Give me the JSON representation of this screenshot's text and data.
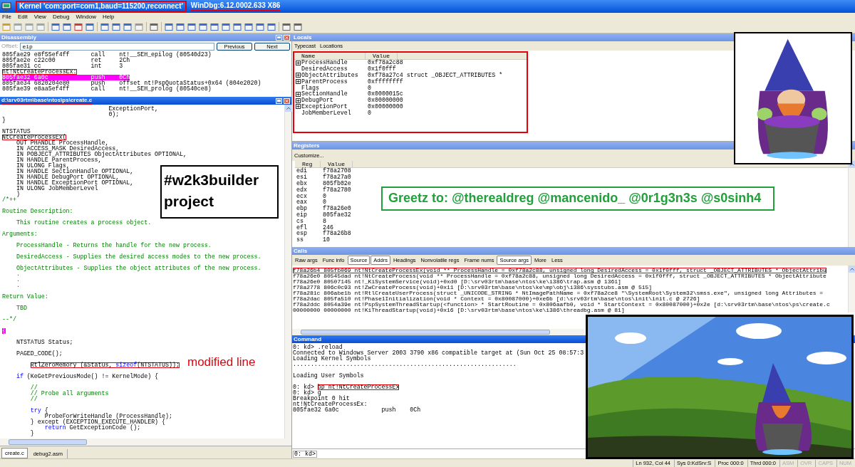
{
  "window": {
    "title": "Kernel 'com:port=com1,baud=115200,reconnect'",
    "version": "WinDbg:6.12.0002.633 X86"
  },
  "menu": [
    "File",
    "Edit",
    "View",
    "Debug",
    "Window",
    "Help"
  ],
  "disassembly": {
    "title": "Disassembly",
    "offset_label": "Offset:",
    "offset_value": "eip",
    "buttons": [
      "Previous",
      "Next"
    ],
    "lines": [
      {
        "text": "805fae29 e8f55ef4ff      call    nt!__SEH_epilog (80540d23)",
        "boxed": false,
        "current": false
      },
      {
        "text": "805fae2e c22c00          ret     2Ch",
        "boxed": false,
        "current": false
      },
      {
        "text": "805fae31 cc              int     3",
        "boxed": false,
        "current": false
      },
      {
        "text": "nt!NtCreateProcessEx:",
        "boxed": true,
        "current": false
      },
      {
        "text": "805fae32 6a0c            push    0Ch",
        "boxed": false,
        "current": true
      },
      {
        "text": "805fae34 6820204e80      push    offset nt!PspQuotaStatus+0x64 (804e2020)",
        "boxed": false,
        "current": false
      },
      {
        "text": "805fae39 e8aa5ef4ff      call    nt!__SEH_prolog (80540ce8)",
        "boxed": false,
        "current": false
      }
    ]
  },
  "source": {
    "title": "d:\\srv03rtm\\base\\ntos\\ps\\create.c",
    "blocks": [
      [
        {
          "text": "                              ExceptionPort,",
          "kind": "code",
          "boxed": false,
          "current": false
        },
        {
          "text": "                              0);",
          "kind": "code",
          "boxed": false,
          "current": false
        },
        {
          "text": "}",
          "kind": "code",
          "boxed": false,
          "current": false
        }
      ],
      [
        {
          "text": "NTSTATUS",
          "kind": "code",
          "boxed": false,
          "current": false
        },
        {
          "text": "NtCreateProcessEx(",
          "kind": "code",
          "boxed": true,
          "current": false
        },
        {
          "text": "    OUT PHANDLE ProcessHandle,",
          "kind": "code",
          "boxed": false,
          "current": false
        },
        {
          "text": "    IN ACCESS_MASK DesiredAccess,",
          "kind": "code",
          "boxed": false,
          "current": false
        },
        {
          "text": "    IN POBJECT_ATTRIBUTES ObjectAttributes OPTIONAL,",
          "kind": "code",
          "boxed": false,
          "current": false
        },
        {
          "text": "    IN HANDLE ParentProcess,",
          "kind": "code",
          "boxed": false,
          "current": false
        },
        {
          "text": "    IN ULONG Flags,",
          "kind": "code",
          "boxed": false,
          "current": false
        },
        {
          "text": "    IN HANDLE SectionHandle OPTIONAL,",
          "kind": "code",
          "boxed": false,
          "current": false
        },
        {
          "text": "    IN HANDLE DebugPort OPTIONAL,",
          "kind": "code",
          "boxed": false,
          "current": false
        },
        {
          "text": "    IN HANDLE ExceptionPort OPTIONAL,",
          "kind": "code",
          "boxed": false,
          "current": false
        },
        {
          "text": "    IN ULONG JobMemberLevel",
          "kind": "code",
          "boxed": false,
          "current": false
        },
        {
          "text": "    )",
          "kind": "code",
          "boxed": false,
          "current": false
        },
        {
          "text": "/*++",
          "kind": "comment",
          "boxed": false,
          "current": false
        }
      ],
      [
        {
          "text": "Routine Description:",
          "kind": "comment",
          "boxed": false,
          "current": false
        }
      ],
      [
        {
          "text": "    This routine creates a process object.",
          "kind": "comment",
          "boxed": false,
          "current": false
        }
      ],
      [
        {
          "text": "Arguments:",
          "kind": "comment",
          "boxed": false,
          "current": false
        }
      ],
      [
        {
          "text": "    ProcessHandle - Returns the handle for the new process.",
          "kind": "comment",
          "boxed": false,
          "current": false
        }
      ],
      [
        {
          "text": "    DesiredAccess - Supplies the desired access modes to the new process.",
          "kind": "comment",
          "boxed": false,
          "current": false
        }
      ],
      [
        {
          "text": "    ObjectAttributes - Supplies the object attributes of the new process.",
          "kind": "comment",
          "boxed": false,
          "current": false
        },
        {
          "text": "    .",
          "kind": "comment",
          "boxed": false,
          "current": false
        },
        {
          "text": "    .",
          "kind": "comment",
          "boxed": false,
          "current": false
        },
        {
          "text": "    .",
          "kind": "comment",
          "boxed": false,
          "current": false
        }
      ],
      [
        {
          "text": "Return Value:",
          "kind": "comment",
          "boxed": false,
          "current": false
        }
      ],
      [
        {
          "text": "    TBD",
          "kind": "comment",
          "boxed": false,
          "current": false
        }
      ],
      [
        {
          "text": "--*/",
          "kind": "comment",
          "boxed": false,
          "current": false
        }
      ],
      [
        {
          "text": "{",
          "kind": "code",
          "boxed": false,
          "current": true
        }
      ],
      [
        {
          "text": "    NTSTATUS Status;",
          "kind": "code",
          "boxed": false,
          "current": false
        }
      ],
      [
        {
          "text": "    PAGED_CODE();",
          "kind": "code",
          "boxed": false,
          "current": false
        }
      ],
      [
        {
          "parts": [
            {
              "text": "        RtlZeroMemory (&Status, ",
              "kind": "code"
            },
            {
              "text": "sizeof",
              "kind": "keyword"
            },
            {
              "text": "(NTSTATUS));",
              "kind": "code"
            }
          ],
          "boxed": true,
          "current": false
        }
      ],
      [
        {
          "parts": [
            {
              "text": "    if",
              "kind": "keyword"
            },
            {
              "text": " (KeGetPreviousMode() != KernelMode) {",
              "kind": "code"
            }
          ],
          "boxed": false,
          "current": false
        }
      ],
      [
        {
          "text": "        //",
          "kind": "comment",
          "boxed": false,
          "current": false
        },
        {
          "text": "        // Probe all arguments",
          "kind": "comment",
          "boxed": false,
          "current": false
        },
        {
          "text": "        //",
          "kind": "comment",
          "boxed": false,
          "current": false
        }
      ],
      [
        {
          "parts": [
            {
              "text": "        try",
              "kind": "keyword"
            },
            {
              "text": " {",
              "kind": "code"
            }
          ],
          "boxed": false,
          "current": false
        },
        {
          "text": "            ProbeForWriteHandle (ProcessHandle);",
          "kind": "code",
          "boxed": false,
          "current": false
        },
        {
          "text": "        } except (EXCEPTION_EXECUTE_HANDLER) {",
          "kind": "code",
          "boxed": false,
          "current": false
        },
        {
          "parts": [
            {
              "text": "            return",
              "kind": "keyword"
            },
            {
              "text": " GetExceptionCode ();",
              "kind": "code"
            }
          ],
          "boxed": false,
          "current": false
        },
        {
          "text": "        }",
          "kind": "code",
          "boxed": false,
          "current": false
        }
      ]
    ],
    "tabs": [
      {
        "label": "create.c",
        "selected": true
      },
      {
        "label": "debug2.asm",
        "selected": false
      }
    ]
  },
  "locals": {
    "title": "Locals",
    "buttons": [
      "Typecast",
      "Locations"
    ],
    "columns": [
      "Name",
      "Value"
    ],
    "rows": [
      {
        "name": "ProcessHandle",
        "value": "0xf78a2c88",
        "expandable": true
      },
      {
        "name": "DesiredAccess",
        "value": "0x1f0fff",
        "expandable": false
      },
      {
        "name": "ObjectAttributes",
        "value": "0xf78a27c4 struct _OBJECT_ATTRIBUTES *",
        "expandable": true
      },
      {
        "name": "ParentProcess",
        "value": "0xffffffff",
        "expandable": true
      },
      {
        "name": "Flags",
        "value": "0",
        "expandable": false
      },
      {
        "name": "SectionHandle",
        "value": "0x0000015c",
        "expandable": true
      },
      {
        "name": "DebugPort",
        "value": "0x00000000",
        "expandable": true
      },
      {
        "name": "ExceptionPort",
        "value": "0x00000000",
        "expandable": true
      },
      {
        "name": "JobMemberLevel",
        "value": "0",
        "expandable": false
      }
    ]
  },
  "registers": {
    "title": "Registers",
    "buttons": [
      "Customize..."
    ],
    "columns": [
      "Reg",
      "Value"
    ],
    "rows": [
      {
        "name": "edi",
        "value": "f78a2708"
      },
      {
        "name": "esi",
        "value": "f78a27a0"
      },
      {
        "name": "ebx",
        "value": "805fb02e"
      },
      {
        "name": "edx",
        "value": "f78a2780"
      },
      {
        "name": "ecx",
        "value": "0"
      },
      {
        "name": "eax",
        "value": "0"
      },
      {
        "name": "ebp",
        "value": "f78a26e0"
      },
      {
        "name": "eip",
        "value": "805fae32"
      },
      {
        "name": "cs",
        "value": "8"
      },
      {
        "name": "efl",
        "value": "246"
      },
      {
        "name": "esp",
        "value": "f78a26b8"
      },
      {
        "name": "ss",
        "value": "10"
      }
    ]
  },
  "calls": {
    "title": "Calls",
    "toggles": [
      {
        "label": "Raw args",
        "on": false
      },
      {
        "label": "Func info",
        "on": false
      },
      {
        "label": "Source",
        "on": true
      },
      {
        "label": "Addrs",
        "on": true
      },
      {
        "label": "Headings",
        "on": false
      },
      {
        "label": "Nonvolatile regs",
        "on": false
      },
      {
        "label": "Frame nums",
        "on": false
      },
      {
        "label": "Source args",
        "on": true
      },
      {
        "label": "More",
        "on": false
      },
      {
        "label": "Less",
        "on": false
      }
    ],
    "lines": [
      {
        "text": "f78a26b4 805fb069 nt!NtCreateProcessEx(void ** ProcessHandle = 0xf78a2c88, unsigned long DesiredAccess = 0x1f0fff, struct _OBJECT_ATTRIBUTES * ObjectAttribu",
        "boxed": true
      },
      {
        "text": "f78a26e0 80545dad nt!NtCreateProcess(void ** ProcessHandle = 0xf78a2c88, unsigned long DesiredAccess = 0x1f0fff, struct _OBJECT_ATTRIBUTES * ObjectAttribute",
        "boxed": false
      },
      {
        "text": "f78a26e0 80507145 nt!_KiSystemService(void)+0xd0 [D:\\srv03rtm\\base\\ntos\\ke\\i386\\trap.asm @ 1361]",
        "boxed": false
      },
      {
        "text": "f78a2778 806c0c93 nt!ZwCreateProcess(void)+0x11 [D:\\srv03rtm\\base\\ntos\\ke\\mp\\obj\\i386\\sysstubs.asm @ 515]",
        "boxed": false
      },
      {
        "text": "f78a281c 806abe1b nt!RtlCreateUserProcess(struct _UNICODE_STRING * NtImagePathName = 0xf78a2ce8 \"\\SystemRoot\\System32\\smss.exe\", unsigned long Attributes =",
        "boxed": false
      },
      {
        "text": "f78a2dac 805fa510 nt!Phase1Initialization(void * Context = 0x80087000)+0xe6b [d:\\srv03rtm\\base\\ntos\\init\\init.c @ 2726]",
        "boxed": false
      },
      {
        "text": "f78a2ddc 8054a39e nt!PspSystemThreadStartup(<function> * StartRoutine = 0x806aafb0, void * StartContext = 0x80087000)+0x2e [d:\\srv03rtm\\base\\ntos\\ps\\create.c",
        "boxed": false
      },
      {
        "text": "00000000 00000000 nt!KiThreadStartup(void)+0x16 [D:\\srv03rtm\\base\\ntos\\ke\\i386\\threadbg.asm @ 81]",
        "boxed": false
      }
    ]
  },
  "command": {
    "title": "Command",
    "prompt": "0: kd>",
    "blocks": [
      [
        {
          "parts": [
            {
              "text": "0: kd> .reload",
              "boxed": false
            }
          ]
        },
        {
          "parts": [
            {
              "text": "Connected to Windows Server 2003 3790 x86 compatible target at (Sun Oct 25 08:57:3",
              "boxed": false
            }
          ]
        },
        {
          "parts": [
            {
              "text": "Loading Kernel Symbols",
              "boxed": false
            }
          ]
        },
        {
          "parts": [
            {
              "text": "...............................................................",
              "boxed": false
            }
          ]
        }
      ],
      [
        {
          "parts": [
            {
              "text": "Loading User Symbols",
              "boxed": false
            }
          ]
        }
      ],
      [
        {
          "parts": [
            {
              "text": "0: kd> ",
              "boxed": false
            },
            {
              "text": "bp nt!NtCreateProcessEx",
              "boxed": true
            }
          ]
        },
        {
          "parts": [
            {
              "text": "0: kd> g",
              "boxed": false
            }
          ]
        },
        {
          "parts": [
            {
              "text": "Breakpoint 0 hit",
              "boxed": false
            }
          ]
        },
        {
          "parts": [
            {
              "text": "nt!NtCreateProcessEx:",
              "boxed": false
            }
          ]
        },
        {
          "parts": [
            {
              "text": "805fae32 6a0c            push    0Ch",
              "boxed": false
            }
          ]
        }
      ]
    ]
  },
  "status_bar": [
    {
      "text": "Ln 932, Col 44",
      "on": true
    },
    {
      "text": "Sys 0:KdSrv:S",
      "on": true
    },
    {
      "text": "Proc 000:0",
      "on": true
    },
    {
      "text": "Thrd 000:0",
      "on": true
    },
    {
      "text": "ASM",
      "on": false
    },
    {
      "text": "OVR",
      "on": false
    },
    {
      "text": "CAPS",
      "on": false
    },
    {
      "text": "NUM",
      "on": false
    }
  ],
  "annotations": [
    {
      "kind": "project",
      "text": "#w2k3builder project"
    },
    {
      "kind": "greetz",
      "text": "Greetz to: @therealdreg @mancenido_ @0r1g3n3s @s0sinh4"
    },
    {
      "kind": "modified",
      "text": "modified line"
    }
  ]
}
